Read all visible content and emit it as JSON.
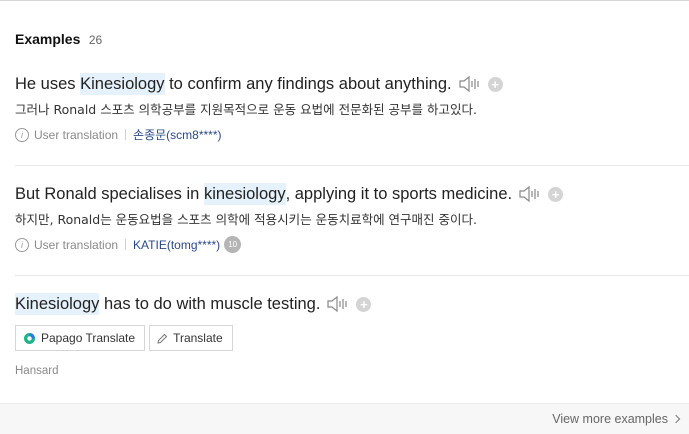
{
  "header": {
    "title": "Examples",
    "count": "26"
  },
  "examples": [
    {
      "pre": "He uses ",
      "highlight": "Kinesiology",
      "post": " to confirm any findings about anything.",
      "translation": "그러나 Ronald 스포츠 의학공부를 지원목적으로 운동 요법에 전문화된 공부를 하고있다.",
      "source_label": "User translation",
      "user": "손종문(scm8****)"
    },
    {
      "pre": "But Ronald specialises in ",
      "highlight": "kinesiology",
      "post": ", applying it to sports medicine.",
      "translation": "하지만, Ronald는 운동요법을 스포츠 의학에 적용시키는 운동치료학에 연구매진 중이다.",
      "source_label": "User translation",
      "user": "KATIE(tomg****)",
      "level": "10"
    },
    {
      "pre": "",
      "highlight": "Kinesiology",
      "post": " has to do with muscle testing.",
      "papago_label": "Papago Translate",
      "translate_label": "Translate",
      "source": "Hansard"
    }
  ],
  "footer": {
    "view_more": "View more examples"
  },
  "colors": {
    "highlight": "#e6f2fb",
    "user_link": "#2b4a86",
    "footer_bg": "#f7f7f7"
  },
  "icons": [
    "speaker-icon",
    "add-icon",
    "info-icon",
    "papago-icon",
    "pencil-icon",
    "chevron-right-icon"
  ]
}
